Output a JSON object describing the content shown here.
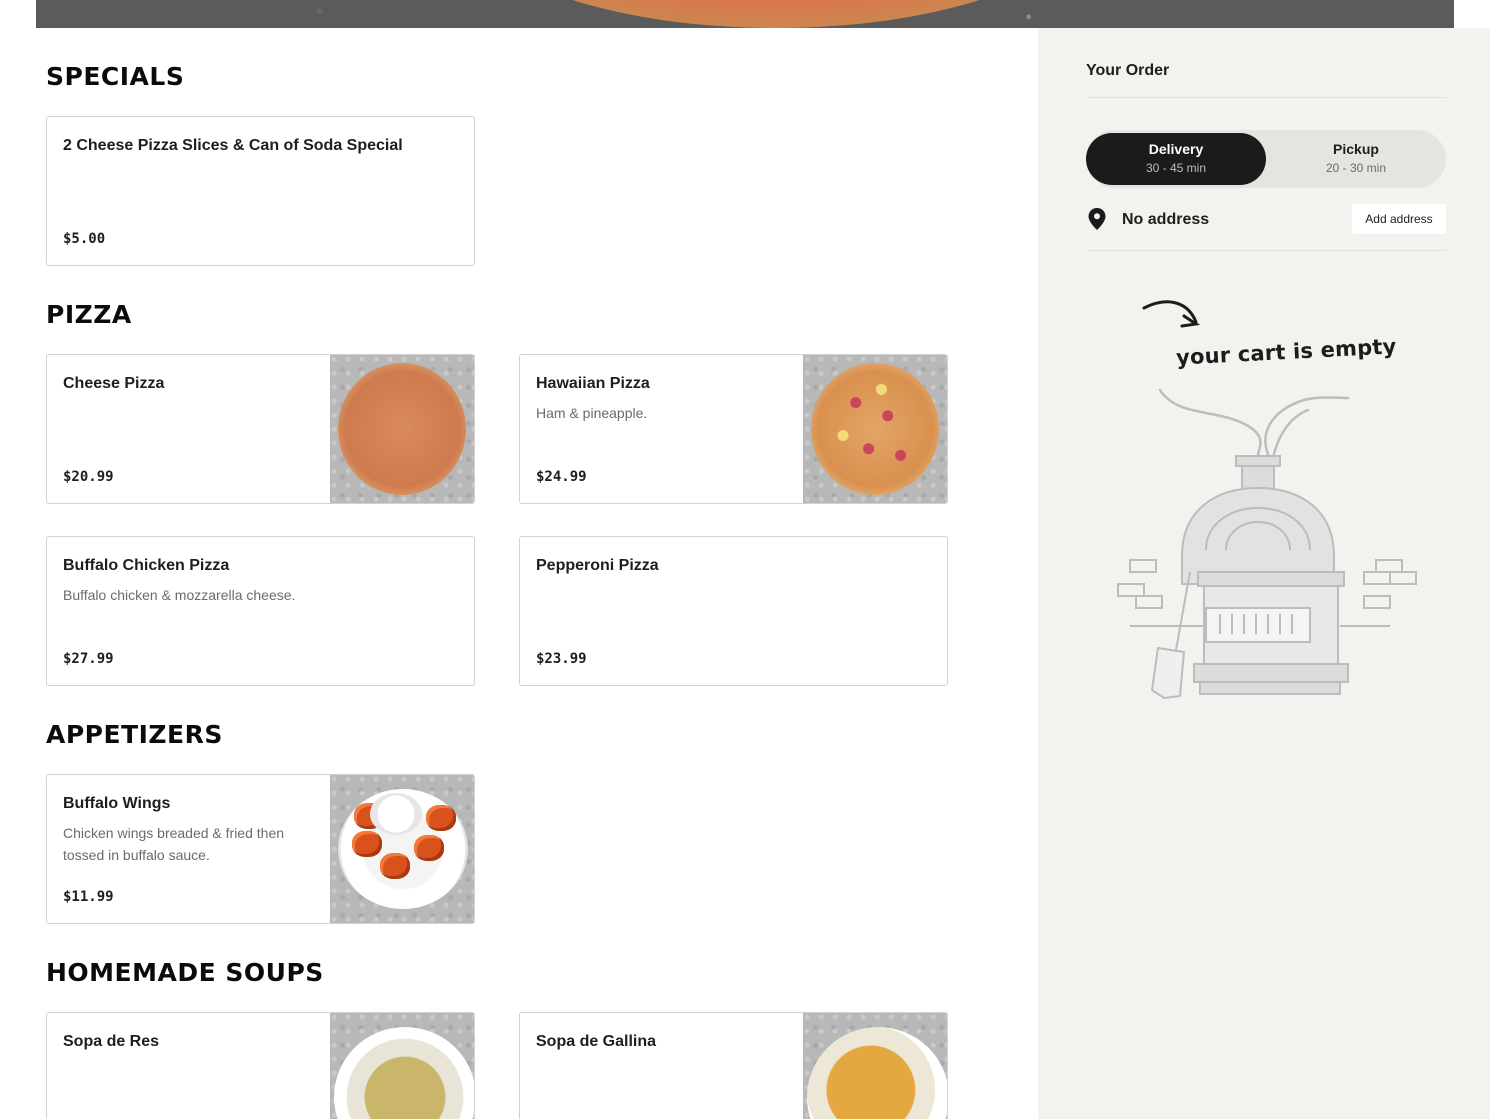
{
  "sections": [
    {
      "title": "SPECIALS",
      "items": [
        {
          "name": "2 Cheese Pizza Slices & Can of Soda Special",
          "description": "",
          "price": "$5.00",
          "image": null
        }
      ]
    },
    {
      "title": "PIZZA",
      "items": [
        {
          "name": "Cheese Pizza",
          "description": "",
          "price": "$20.99",
          "image": "cheese-pizza-photo"
        },
        {
          "name": "Hawaiian Pizza",
          "description": "Ham & pineapple.",
          "price": "$24.99",
          "image": "hawaiian-pizza-photo"
        },
        {
          "name": "Buffalo Chicken Pizza",
          "description": "Buffalo chicken & mozzarella cheese.",
          "price": "$27.99",
          "image": null
        },
        {
          "name": "Pepperoni Pizza",
          "description": "",
          "price": "$23.99",
          "image": null
        }
      ]
    },
    {
      "title": "APPETIZERS",
      "items": [
        {
          "name": "Buffalo Wings",
          "description": "Chicken wings breaded & fried then tossed in buffalo sauce.",
          "price": "$11.99",
          "image": "buffalo-wings-photo"
        }
      ]
    },
    {
      "title": "HOMEMADE SOUPS",
      "items": [
        {
          "name": "Sopa de Res",
          "description": "",
          "price": "",
          "image": "sopa-de-res-photo"
        },
        {
          "name": "Sopa de Gallina",
          "description": "",
          "price": "",
          "image": "sopa-de-gallina-photo"
        }
      ]
    }
  ],
  "order": {
    "title": "Your Order",
    "modes": [
      {
        "label": "Delivery",
        "time": "30 - 45 min",
        "selected": true
      },
      {
        "label": "Pickup",
        "time": "20 - 30 min",
        "selected": false
      }
    ],
    "address": {
      "text": "No address",
      "button_label": "Add address",
      "icon": "location-pin-icon"
    },
    "empty_message": "your cart is empty",
    "empty_illustration": "pizza-oven-illustration"
  },
  "colors": {
    "sidebar_bg": "#f3f2ef",
    "toggle_active": "#1b1b1b",
    "card_border": "#d2d2d2"
  }
}
